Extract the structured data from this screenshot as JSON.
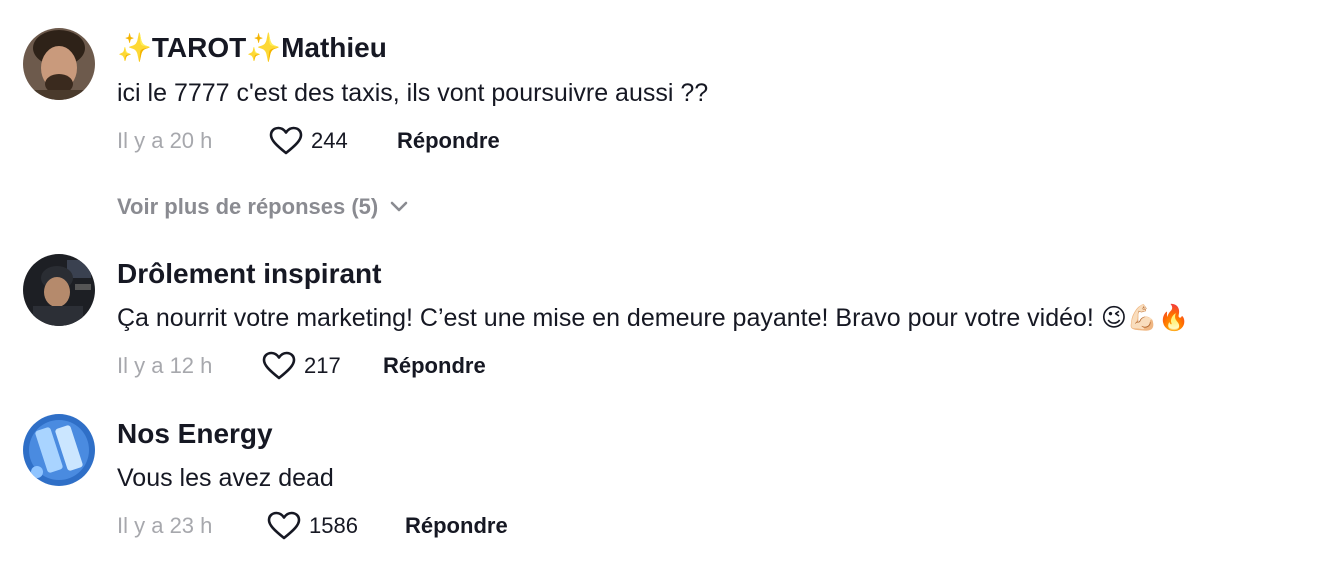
{
  "comments": [
    {
      "username": "✨TAROT✨Mathieu",
      "text": "ici le 7777 c'est des taxis, ils vont poursuivre aussi ??",
      "time": "Il y a 20 h",
      "likes": "244",
      "reply_label": "Répondre",
      "more_replies": "Voir plus de réponses (5)"
    },
    {
      "username": "Drôlement inspirant",
      "text": "Ça nourrit votre marketing! C’est une mise en demeure payante! Bravo pour votre vidéo! 😉💪🏻🔥",
      "time": "Il y a 12 h",
      "likes": "217",
      "reply_label": "Répondre"
    },
    {
      "username": "Nos Energy",
      "text": "Vous les avez dead",
      "time": "Il y a 23 h",
      "likes": "1586",
      "reply_label": "Répondre"
    }
  ],
  "colors": {
    "text_primary": "#161823",
    "text_secondary": "#a7a8ad",
    "link_muted": "#8a8b91"
  },
  "icons": {
    "like": "heart-outline-icon",
    "expand": "chevron-down-icon"
  }
}
